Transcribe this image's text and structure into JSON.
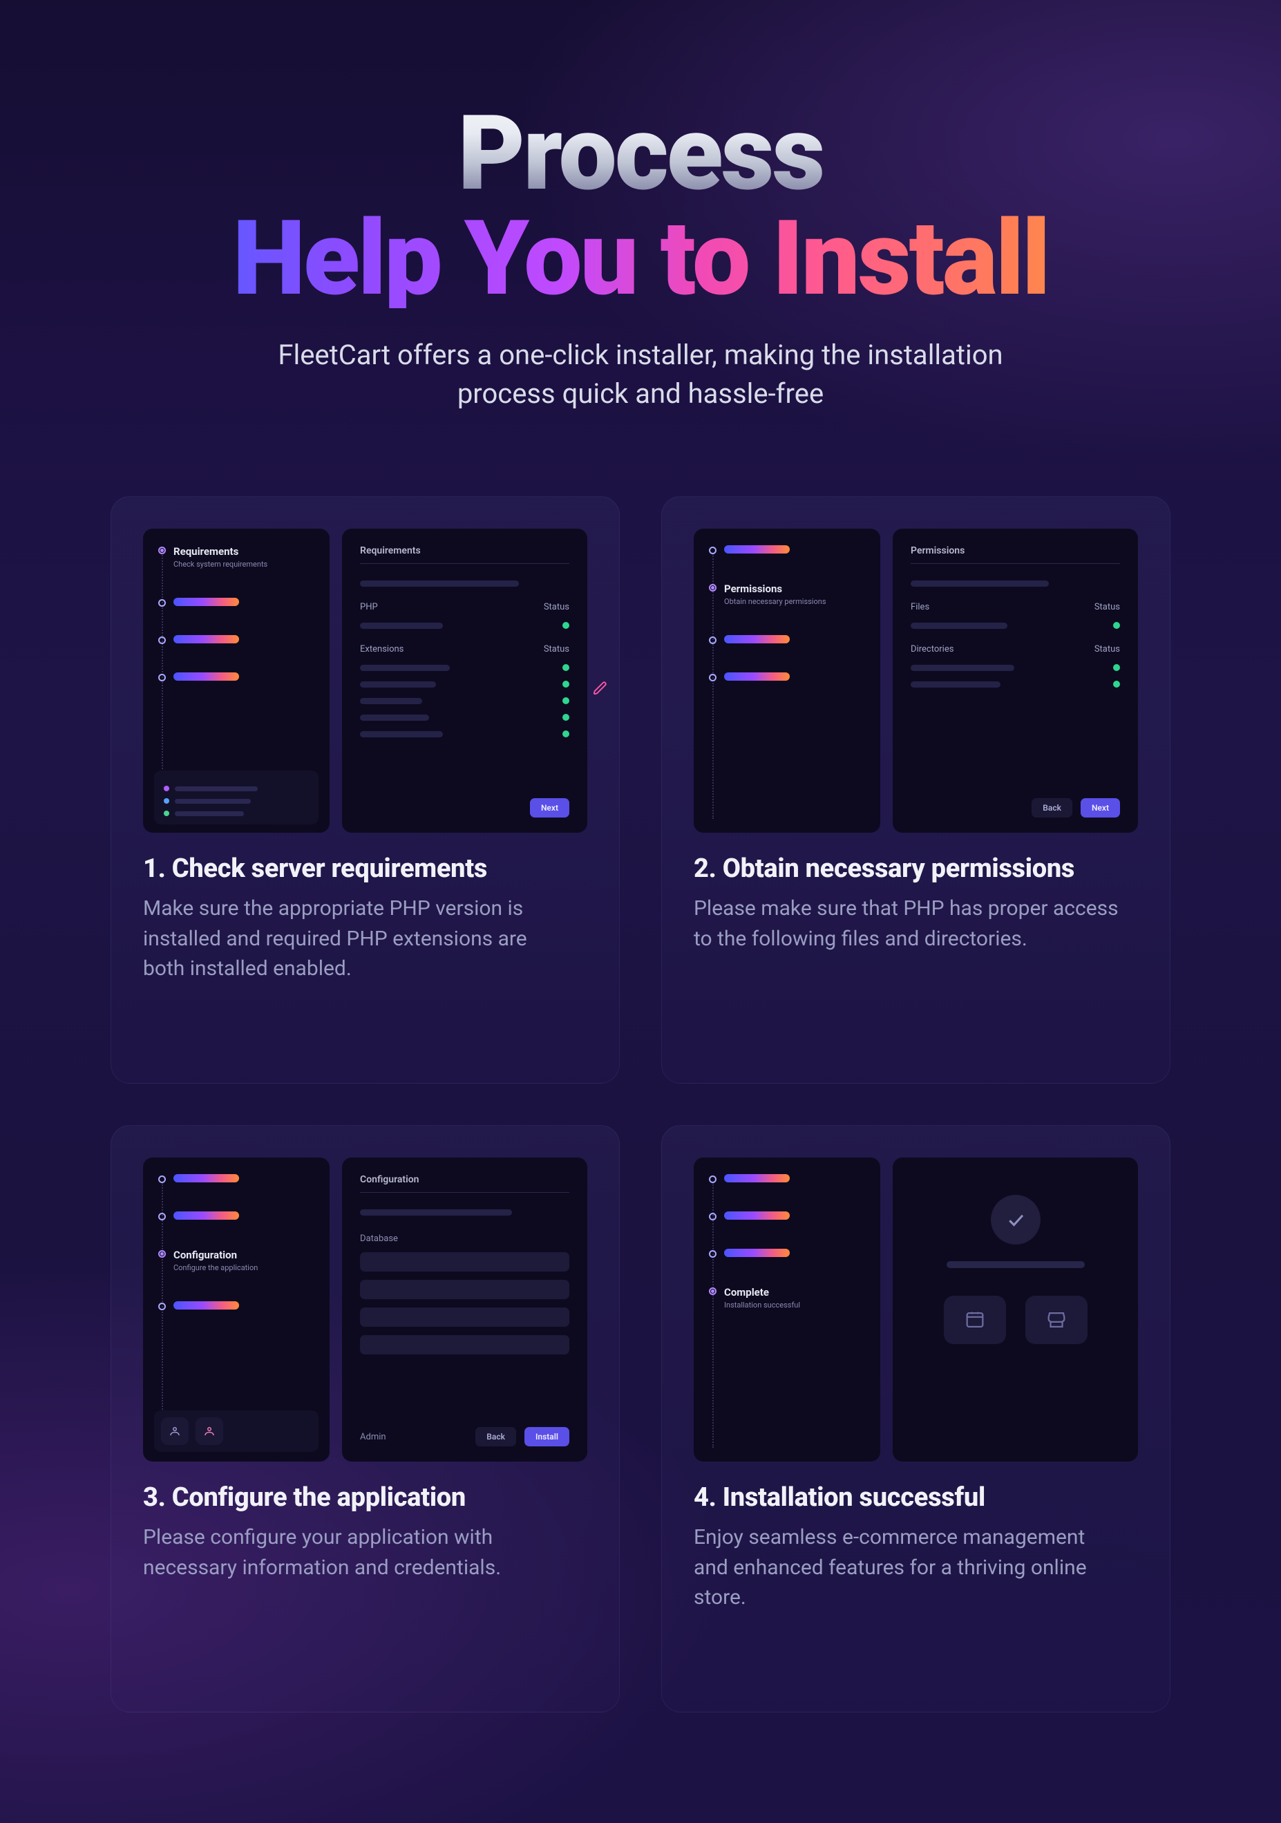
{
  "hero": {
    "title_l1": "Process",
    "title_l2": "Help You to Install",
    "sub": "FleetCart offers a one-click installer, making the installation process quick and hassle-free"
  },
  "steps": [
    {
      "num": "1.",
      "title": "Check server requirements",
      "desc": "Make sure the appropriate PHP version is installed and required PHP extensions are both installed enabled.",
      "sidebar": {
        "active_title": "Requirements",
        "active_sub": "Check system requirements"
      },
      "panel": {
        "title": "Requirements",
        "row1_label": "PHP",
        "row1_right": "Status",
        "row2_label": "Extensions",
        "row2_right": "Status",
        "next": "Next"
      }
    },
    {
      "num": "2.",
      "title": "Obtain necessary permissions",
      "desc": "Please make sure that PHP has proper access to the following files and directories.",
      "sidebar": {
        "active_title": "Permissions",
        "active_sub": "Obtain necessary permissions"
      },
      "panel": {
        "title": "Permissions",
        "row1_label": "Files",
        "row1_right": "Status",
        "row2_label": "Directories",
        "row2_right": "Status",
        "back": "Back",
        "next": "Next"
      }
    },
    {
      "num": "3.",
      "title": "Configure the application",
      "desc": "Please configure your application with necessary information and credentials.",
      "sidebar": {
        "active_title": "Configuration",
        "active_sub": "Configure the application"
      },
      "panel": {
        "title": "Configuration",
        "section_label": "Database",
        "admin_label": "Admin",
        "back": "Back",
        "install": "Install"
      }
    },
    {
      "num": "4.",
      "title": "Installation successful",
      "desc": "Enjoy seamless e-commerce management and enhanced features for a thriving online store.",
      "sidebar": {
        "active_title": "Complete",
        "active_sub": "Installation successful"
      }
    }
  ]
}
